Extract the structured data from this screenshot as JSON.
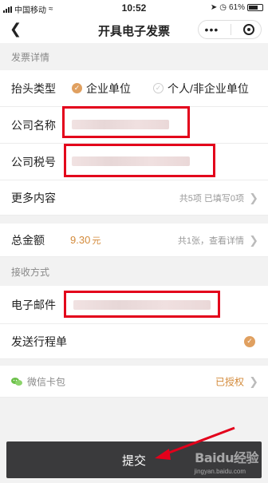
{
  "status_bar": {
    "carrier": "中国移动",
    "time": "10:52",
    "battery": "61%"
  },
  "nav": {
    "back_icon": "chevron-left-icon",
    "title": "开具电子发票",
    "more_dots": "•••"
  },
  "invoice_details": {
    "section_title": "发票详情",
    "header_type_label": "抬头类型",
    "header_type_options": [
      {
        "label": "企业单位",
        "selected": true
      },
      {
        "label": "个人/非企业单位",
        "selected": false
      }
    ],
    "company_name_label": "公司名称",
    "tax_id_label": "公司税号",
    "more_label": "更多内容",
    "more_summary": "共5项 已填写0项"
  },
  "total": {
    "label": "总金额",
    "amount": "9.30",
    "unit": "元",
    "summary": "共1张，查看详情"
  },
  "receive": {
    "section_title": "接收方式",
    "email_label": "电子邮件",
    "send_itinerary_label": "发送行程单",
    "send_itinerary_checked": true
  },
  "wallet": {
    "label": "微信卡包",
    "status": "已授权"
  },
  "submit_label": "提交",
  "watermark": {
    "brand": "Baidu经验",
    "url": "jingyan.baidu.com"
  },
  "colors": {
    "accent": "#d38a3a",
    "highlight_box": "#e3001b",
    "submit_bg": "#3a3a3c"
  }
}
